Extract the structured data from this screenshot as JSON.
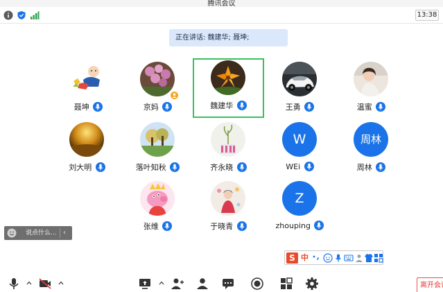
{
  "window": {
    "title": "腾讯会议"
  },
  "status": {
    "clock": "13:38"
  },
  "banner": {
    "text": "正在讲话: 魏建华; 聂坤;"
  },
  "participants": [
    {
      "name": "聂坤"
    },
    {
      "name": "京妈",
      "host": true
    },
    {
      "name": "魏建华",
      "active": true
    },
    {
      "name": "王勇"
    },
    {
      "name": "温蜜"
    },
    {
      "name": "刘大明"
    },
    {
      "name": "落叶知秋"
    },
    {
      "name": "齐永晓"
    },
    {
      "name": "WEi",
      "letter": "W"
    },
    {
      "name": "周林",
      "letter": "周林"
    },
    {
      "name": "张维"
    },
    {
      "name": "于晓青"
    },
    {
      "name": "zhouping",
      "letter": "Z"
    }
  ],
  "chat": {
    "placeholder": "说点什么...",
    "collapse": "‹"
  },
  "ime": {
    "logo": "S",
    "mode": "中"
  },
  "toolbar": {
    "leave_label": "离开会议"
  },
  "colors": {
    "accent": "#1a73e8",
    "active_border": "#37c05d",
    "leave": "#e33b3b"
  },
  "icons": [
    "info-icon",
    "shield-icon",
    "signal-icon",
    "mic-icon",
    "host-icon",
    "smiley-icon",
    "video-off-icon",
    "share-screen-icon",
    "invite-icon",
    "members-icon",
    "chat-icon",
    "record-icon",
    "apps-icon",
    "settings-icon"
  ]
}
